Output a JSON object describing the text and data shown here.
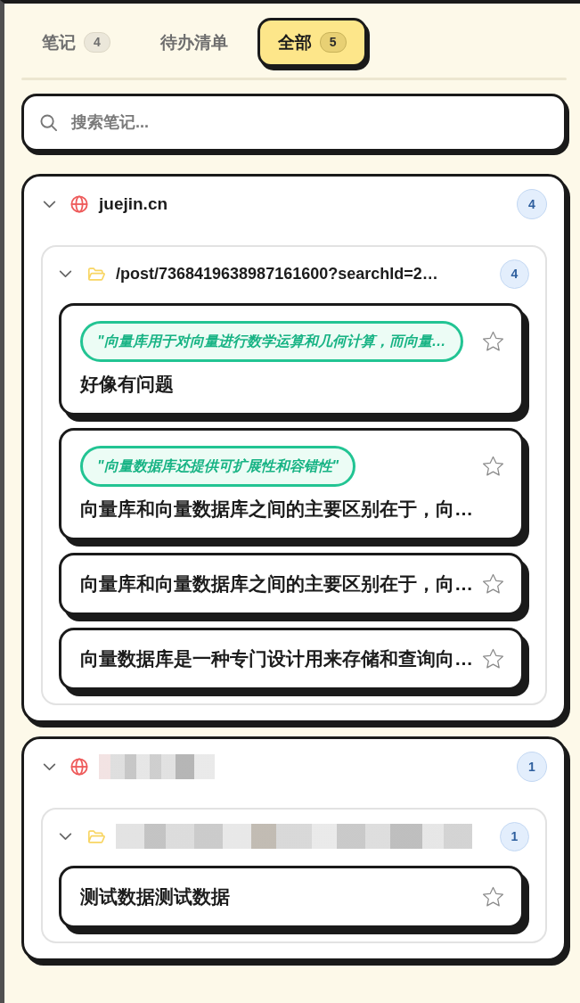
{
  "tabs": [
    {
      "label": "笔记",
      "count": "4",
      "selected": false
    },
    {
      "label": "待办清单",
      "selected": false
    },
    {
      "label": "全部",
      "count": "5",
      "selected": true
    }
  ],
  "search": {
    "placeholder": "搜索笔记..."
  },
  "sites": [
    {
      "domain": "juejin.cn",
      "redacted": false,
      "count": "4",
      "expanded": true,
      "folders": [
        {
          "path": "/post/7368419638987161600?searchId=2…",
          "redacted": false,
          "count": "4",
          "expanded": true,
          "notes": [
            {
              "highlight": "\"向量库用于对向量进行数学运算和几何计算，而向量…",
              "title": "好像有问题",
              "starred": false
            },
            {
              "highlight": "\"向量数据库还提供可扩展性和容错性\"",
              "title": "向量库和向量数据库之间的主要区别在于，向…",
              "starred": false
            },
            {
              "title": "向量库和向量数据库之间的主要区别在于，向…",
              "starred": false
            },
            {
              "title": "向量数据库是一种专门设计用来存储和查询向…",
              "starred": false
            }
          ]
        }
      ]
    },
    {
      "redacted": true,
      "count": "1",
      "expanded": true,
      "folders": [
        {
          "redacted": true,
          "count": "1",
          "expanded": true,
          "notes": [
            {
              "title": "测试数据测试数据",
              "starred": false
            }
          ]
        }
      ]
    }
  ]
}
